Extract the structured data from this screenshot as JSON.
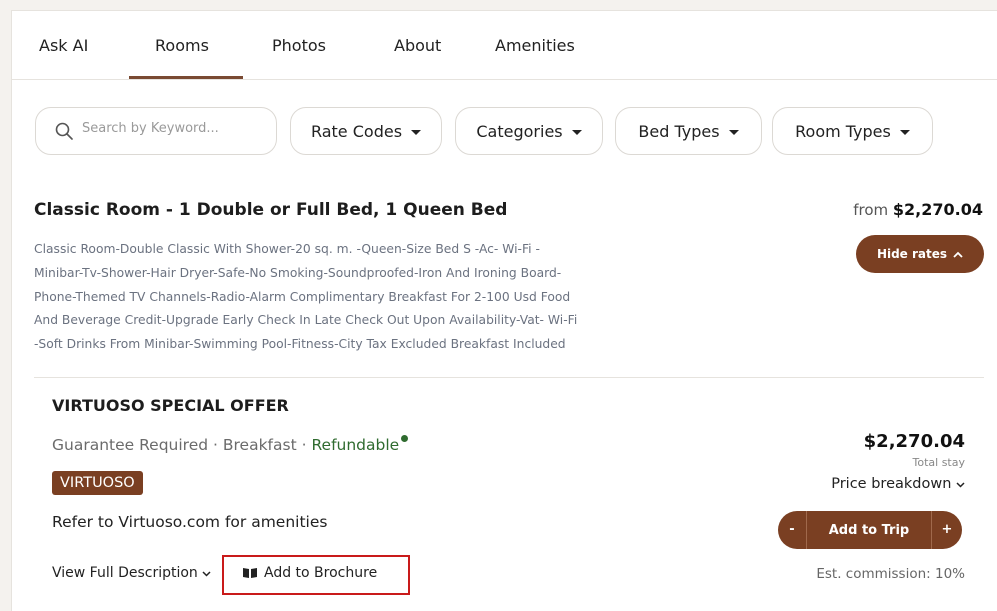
{
  "tabs": [
    {
      "label": "Ask AI"
    },
    {
      "label": "Rooms"
    },
    {
      "label": "Photos"
    },
    {
      "label": "About"
    },
    {
      "label": "Amenities"
    }
  ],
  "active_tab": "Rooms",
  "search": {
    "placeholder": "Search by Keyword..."
  },
  "filters": [
    {
      "label": "Rate Codes"
    },
    {
      "label": "Categories"
    },
    {
      "label": "Bed Types"
    },
    {
      "label": "Room Types"
    }
  ],
  "room": {
    "title": "Classic Room - 1 Double or Full Bed, 1 Queen Bed",
    "from_label": "from",
    "from_price": "$2,270.04",
    "hide_rates_label": "Hide rates",
    "description_lines": [
      "Classic Room-Double Classic With Shower-20 sq. m. -Queen-Size Bed S -Ac- Wi-Fi -",
      "Minibar-Tv-Shower-Hair Dryer-Safe-No Smoking-Soundproofed-Iron And Ironing Board-",
      "Phone-Themed TV Channels-Radio-Alarm Complimentary Breakfast For 2-100 Usd Food",
      "And Beverage Credit-Upgrade Early Check In Late Check Out Upon Availability-Vat- Wi-Fi",
      "-Soft Drinks From Minibar-Swimming Pool-Fitness-City Tax Excluded Breakfast Included"
    ]
  },
  "offer": {
    "title": "VIRTUOSO SPECIAL OFFER",
    "meta_1": "Guarantee Required",
    "sep": " · ",
    "meta_2": "Breakfast",
    "refundable": "Refundable",
    "badge": "VIRTUOSO",
    "amenities_note": "Refer to Virtuoso.com for amenities",
    "view_description": "View Full Description",
    "add_to_brochure": "Add to Brochure",
    "price": "$2,270.04",
    "total_stay": "Total stay",
    "price_breakdown": "Price breakdown",
    "minus": "-",
    "add_to_trip": "Add to Trip",
    "plus": "+",
    "commission": "Est. commission: 10%"
  },
  "colors": {
    "brand_brown": "#7a3f22",
    "refundable_green": "#2f6b2f",
    "highlight_red": "#c91a1a"
  }
}
